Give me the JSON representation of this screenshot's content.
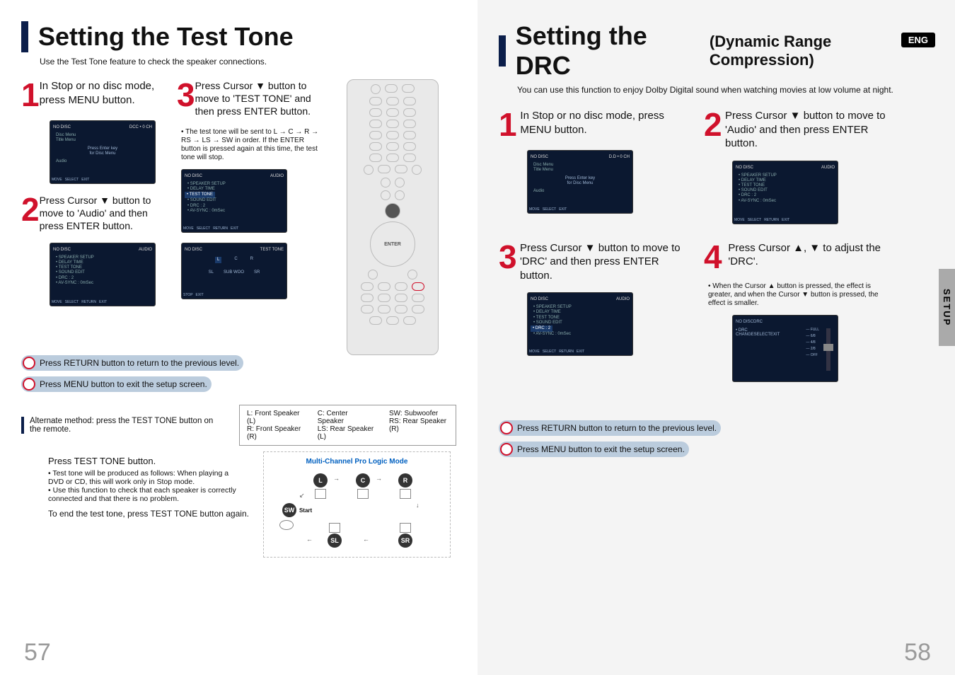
{
  "left": {
    "title": "Setting the Test Tone",
    "subtitle": "Use the Test Tone feature to check the speaker connections.",
    "step1": "In Stop or no disc mode, press MENU button.",
    "step2": "Press Cursor ▼ button to move to 'Audio' and then press ENTER button.",
    "step3": "Press Cursor ▼ button to move to 'TEST TONE' and then press ENTER button.",
    "step3_note": "• The test tone will be sent to L → C → R → RS → LS → SW in order. If the ENTER button is pressed again at this time, the test tone will stop.",
    "return_line": "Press RETURN button to return to the previous level.",
    "menu_line": "Press MENU button to exit the setup screen.",
    "alt_method": "Alternate method: press the TEST TONE button on the remote.",
    "legend": {
      "l": "L: Front Speaker (L)",
      "c": "C: Center Speaker",
      "sw": "SW: Subwoofer",
      "r": "R: Front Speaker (R)",
      "ls": "LS: Rear Speaker (L)",
      "rs": "RS: Rear Speaker (R)"
    },
    "tt_heading": "Press TEST TONE button.",
    "tt_b1": "• Test tone will be produced as follows: When playing a DVD or CD, this will work only in Stop mode.",
    "tt_b2": "• Use this function to check that each speaker is correctly connected and that there is no problem.",
    "end_tone": "To end the test tone, press TEST TONE button again.",
    "diagram_title": "Multi-Channel Pro Logic Mode",
    "diagram_start": "Start",
    "page_num": "57",
    "scr1": {
      "hdr_l": "NO DISC",
      "hdr_r": "DCC • 0 CH",
      "line1": "Press Enter key",
      "line2": "for Disc Menu",
      "menu1": "Disc Menu",
      "menu2": "Title Menu",
      "menu3": "Audio",
      "ftr1": "MOVE",
      "ftr2": "SELECT",
      "ftr3": "EXIT"
    },
    "scr2": {
      "hdr_l": "NO DISC",
      "hdr_r": "AUDIO",
      "i1": "• SPEAKER SETUP",
      "i2": "• DELAY TIME",
      "i3": "• TEST TONE",
      "i4": "• SOUND EDIT",
      "i5": "• DRC        : 2",
      "i6": "• AV-SYNC   : 0mSec",
      "ftr1": "MOVE",
      "ftr2": "SELECT",
      "ftr3": "RETURN",
      "ftr4": "EXIT"
    },
    "scr3": {
      "hdr_l": "NO DISC",
      "hdr_r": "AUDIO",
      "i1_hl": "• TEST TONE",
      "ftr1": "MOVE",
      "ftr2": "SELECT",
      "ftr3": "RETURN",
      "ftr4": "EXIT"
    },
    "scr4": {
      "hdr_l": "NO DISC",
      "hdr_r": "TEST TONE",
      "box_l": "L",
      "box_c": "C",
      "box_r": "R",
      "box_sl": "SL",
      "box_sw": "SUB\nWOO",
      "box_sr": "SR",
      "ftr1": "STOP",
      "ftr2": "EXIT"
    }
  },
  "right": {
    "title_main": "Setting the DRC",
    "title_sub": "(Dynamic Range Compression)",
    "eng": "ENG",
    "subtitle": "You can use this function to enjoy Dolby Digital sound when watching movies at low volume at night.",
    "step1": "In Stop or no disc mode, press MENU button.",
    "step2": "Press Cursor ▼ button to move to 'Audio' and then press ENTER button.",
    "step3": "Press Cursor ▼ button to move to 'DRC' and then press ENTER button.",
    "step4": "Press Cursor ▲, ▼ to adjust the 'DRC'.",
    "step4_note": "• When the Cursor ▲ button is pressed, the effect is greater, and when the Cursor ▼ button is pressed, the effect is smaller.",
    "return_line": "Press RETURN button to return to the previous level.",
    "menu_line": "Press MENU button to exit the setup screen.",
    "setup_tab": "SETUP",
    "page_num": "58",
    "scrA": {
      "hdr_l": "NO DISC",
      "hdr_r": "D.D • 0 CH",
      "line1": "Press Enter key",
      "line2": "for Disc Menu",
      "menu1": "Disc Menu",
      "menu2": "Title Menu",
      "menu3": "Audio",
      "ftr1": "MOVE",
      "ftr2": "SELECT",
      "ftr3": "EXIT"
    },
    "scrB": {
      "hdr_l": "NO DISC",
      "hdr_r": "AUDIO",
      "i1": "• SPEAKER SETUP",
      "i2": "• DELAY TIME",
      "i3": "• TEST TONE",
      "i4": "• SOUND EDIT",
      "i5": "• DRC        : 2",
      "i6": "• AV-SYNC   : 0mSec",
      "ftr1": "MOVE",
      "ftr2": "SELECT",
      "ftr3": "RETURN",
      "ftr4": "EXIT"
    },
    "scrC": {
      "hdr_l": "NO DISC",
      "hdr_r": "AUDIO",
      "i1": "• SPEAKER SETUP",
      "i2": "• DELAY TIME",
      "i3": "• TEST TONE",
      "i4": "• SOUND EDIT",
      "i5_hl": "• DRC        : 2",
      "i6": "• AV-SYNC   : 0mSec",
      "ftr1": "MOVE",
      "ftr2": "SELECT",
      "ftr3": "RETURN",
      "ftr4": "EXIT"
    },
    "scrD": {
      "hdr_l": "NO DISC",
      "hdr_r": "DRC",
      "label": "• DRC",
      "full": "— FULL",
      "v68": "— 6/8",
      "v48": "— 4/8",
      "v28": "— 2/8",
      "off": "— OFF",
      "ftr1": "CHANGE",
      "ftr2": "SELECT",
      "ftr3": "EXIT"
    }
  }
}
